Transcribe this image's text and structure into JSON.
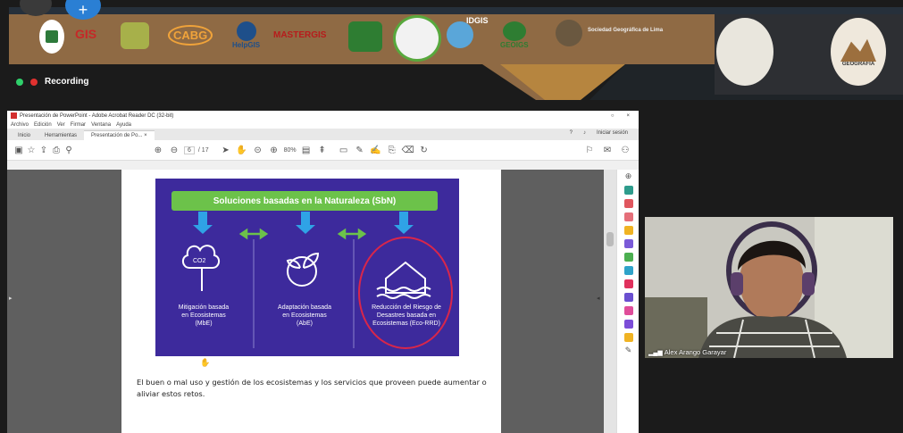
{
  "banner": {
    "logos": [
      "GIS",
      "CABG",
      "HelpGIS",
      "MASTERGIS",
      "IDGIS",
      "GEOIGS"
    ],
    "society_text": "Sociedad Geográfica de Lima",
    "right_seal_text": "GEOGRAFÍA",
    "colors": {
      "dark": "#26303b",
      "brown": "#8f6a44",
      "gold": "#b6853f"
    }
  },
  "recording": {
    "label": "Recording",
    "dot_green": "#2fd06b",
    "dot_red": "#e0312f"
  },
  "acrobat": {
    "title": "Presentación de PowerPoint - Adobe Acrobat Reader DC (32-bit)",
    "menu": [
      "Archivo",
      "Edición",
      "Ver",
      "Firmar",
      "Ventana",
      "Ayuda"
    ],
    "tabs": [
      "Inicio",
      "Herramientas",
      "Presentación de Po... ×"
    ],
    "sign_in": "Iniciar sesión",
    "page_current": "6",
    "page_total": "/ 17",
    "zoom": "80%",
    "window_controls": [
      "○",
      "×"
    ]
  },
  "slide": {
    "banner_title": "Soluciones basadas en la Naturaleza (SbN)",
    "columns": [
      {
        "text": "Mitigación basada en Ecosistemas (MbE)"
      },
      {
        "text": "Adaptación basada en Ecosistemas (AbE)"
      },
      {
        "text": "Reducción del Riesgo de Desastres basada en Ecosistemas (Eco-RRD)"
      }
    ],
    "co2_label": "CO2",
    "colors": {
      "background": "#3d2a9c",
      "banner": "#6cc24a",
      "arrow": "#2fa3e6",
      "sideArrow": "#6cc24a",
      "circle": "#d9264a"
    }
  },
  "caption": "El buen o mal uso y gestión de los ecosistemas y los servicios que proveen puede aumentar o aliviar estos retos.",
  "webcam": {
    "name": "Alex Arango Garayar"
  }
}
